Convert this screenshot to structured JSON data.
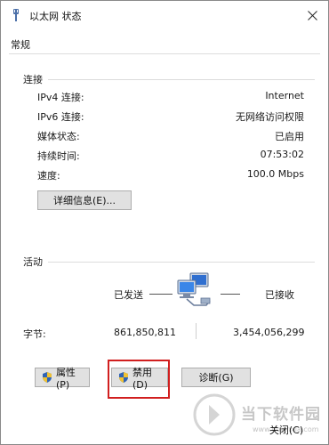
{
  "window": {
    "title": "以太网 状态",
    "tab": "常规"
  },
  "connection": {
    "header": "连接",
    "rows": [
      {
        "label": "IPv4 连接:",
        "value": "Internet"
      },
      {
        "label": "IPv6 连接:",
        "value": "无网络访问权限"
      },
      {
        "label": "媒体状态:",
        "value": "已启用"
      },
      {
        "label": "持续时间:",
        "value": "07:53:02"
      },
      {
        "label": "速度:",
        "value": "100.0 Mbps"
      }
    ],
    "details_button": "详细信息(E)..."
  },
  "activity": {
    "header": "活动",
    "sent_label": "已发送",
    "received_label": "已接收",
    "bytes_label": "字节:",
    "bytes_sent": "861,850,811",
    "bytes_received": "3,454,056,299"
  },
  "buttons": {
    "properties": "属性(P)",
    "disable": "禁用(D)",
    "diagnose": "诊断(G)",
    "close": "关闭(C)"
  },
  "watermark": {
    "text": "当下软件园",
    "sub": "www.downxia.com"
  },
  "colors": {
    "highlight": "#d11f1f",
    "button_bg": "#e1e1e1",
    "button_border": "#adadad"
  }
}
